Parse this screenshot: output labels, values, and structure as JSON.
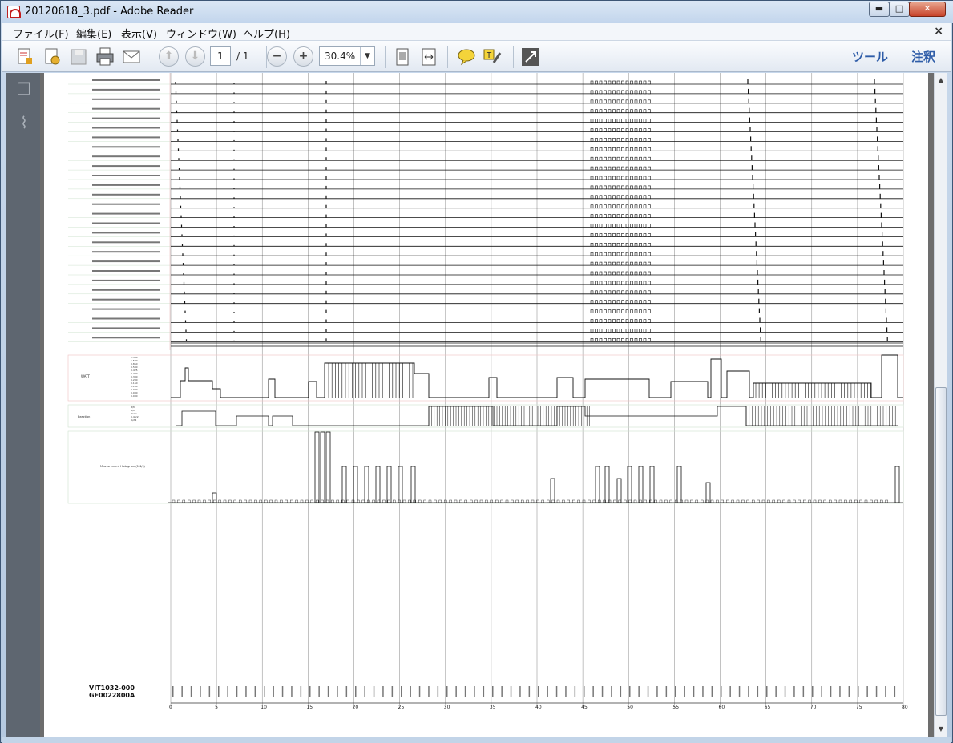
{
  "window": {
    "title": "20120618_3.pdf - Adobe Reader",
    "controls": {
      "minimize": "▬",
      "maximize": "□",
      "close": "✕"
    }
  },
  "menu": {
    "items": [
      "ファイル(F)",
      "編集(E)",
      "表示(V)",
      "ウィンドウ(W)",
      "ヘルプ(H)"
    ],
    "close_doc": "×"
  },
  "toolbar": {
    "page_current": "1",
    "page_total": "/ 1",
    "zoom": "30.4%",
    "tools_label": "ツール",
    "comment_label": "注釈"
  },
  "document": {
    "part_number": "VIT1032-000",
    "code": "GF0022800A",
    "channel_rows": 28,
    "x_axis_ticks": [
      "0",
      "5",
      "10",
      "15",
      "20",
      "25",
      "30",
      "35",
      "40",
      "45",
      "50",
      "55",
      "60",
      "65",
      "70",
      "75",
      "80"
    ],
    "watt_label": "WATT",
    "watt_scale": [
      "2.500",
      "1.500",
      "0.850",
      "0.500",
      "0.425",
      "0.400",
      "0.300",
      "0.200",
      "0.150",
      "0.100",
      "0.000",
      "0.000",
      "0.000"
    ],
    "beacon_label": "Beaction",
    "beacon_scale": [
      "B/M",
      "A/C",
      "Drew",
      "0.44/2",
      "O/A4"
    ],
    "histogram_label": "Measurement Histogram (1/4/s)"
  }
}
